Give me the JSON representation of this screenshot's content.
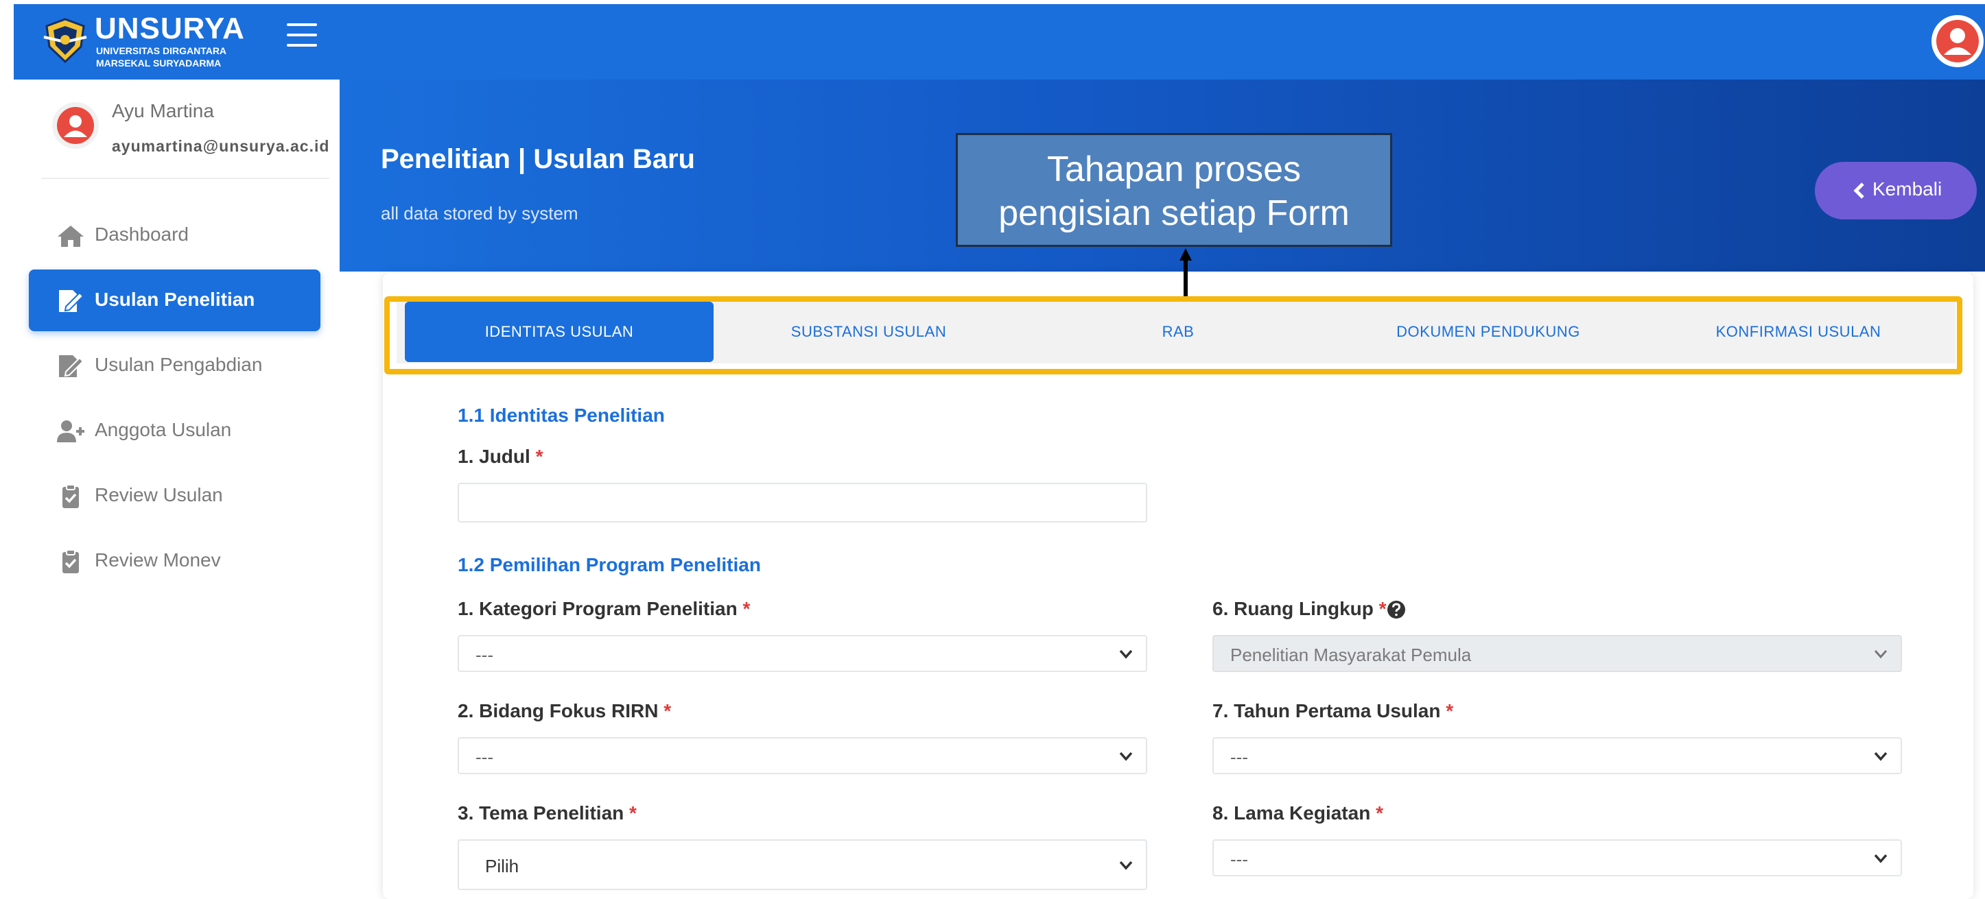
{
  "brand": {
    "name": "UNSURYA",
    "subtitle_line1": "UNIVERSITAS DIRGANTARA",
    "subtitle_line2": "MARSEKAL SURYADARMA"
  },
  "user": {
    "name": "Ayu Martina",
    "email": "ayumartina@unsurya.ac.id"
  },
  "sidebar": {
    "items": [
      {
        "label": "Dashboard",
        "icon": "home-icon",
        "active": false
      },
      {
        "label": "Usulan Penelitian",
        "icon": "edit-document-icon",
        "active": true
      },
      {
        "label": "Usulan Pengabdian",
        "icon": "edit-document-icon",
        "active": false
      },
      {
        "label": "Anggota Usulan",
        "icon": "user-plus-icon",
        "active": false
      },
      {
        "label": "Review Usulan",
        "icon": "clipboard-check-icon",
        "active": false
      },
      {
        "label": "Review Monev",
        "icon": "clipboard-check-icon",
        "active": false
      }
    ]
  },
  "header": {
    "title": "Penelitian | Usulan Baru",
    "subtitle": "all data stored by system",
    "back_label": "Kembali"
  },
  "annotation": {
    "line1": "Tahapan proses",
    "line2": "pengisian setiap Form"
  },
  "tabs": [
    {
      "label": "IDENTITAS USULAN",
      "active": true
    },
    {
      "label": "SUBSTANSI USULAN",
      "active": false
    },
    {
      "label": "RAB",
      "active": false
    },
    {
      "label": "DOKUMEN PENDUKUNG",
      "active": false
    },
    {
      "label": "KONFIRMASI USULAN",
      "active": false
    }
  ],
  "form": {
    "section1_title": "1.1 Identitas Penelitian",
    "judul_label": "1. Judul",
    "judul_value": "",
    "section2_title": "1.2 Pemilihan Program Penelitian",
    "required_mark": "*",
    "fields": {
      "kategori": {
        "label": "1. Kategori Program Penelitian",
        "value": "---"
      },
      "bidang": {
        "label": "2. Bidang Fokus RIRN",
        "value": "---"
      },
      "tema": {
        "label": "3. Tema Penelitian",
        "value": "Pilih"
      },
      "ruang": {
        "label": "6. Ruang Lingkup",
        "value": "Penelitian Masyarakat Pemula"
      },
      "tahun": {
        "label": "7. Tahun Pertama Usulan",
        "value": "---"
      },
      "lama": {
        "label": "8. Lama Kegiatan",
        "value": "---"
      }
    }
  },
  "colors": {
    "primary": "#1a6fdc",
    "highlight": "#f5b70c",
    "back_button": "#6f5bd6",
    "callout": "#4f81bd",
    "required": "#e03a3a"
  }
}
